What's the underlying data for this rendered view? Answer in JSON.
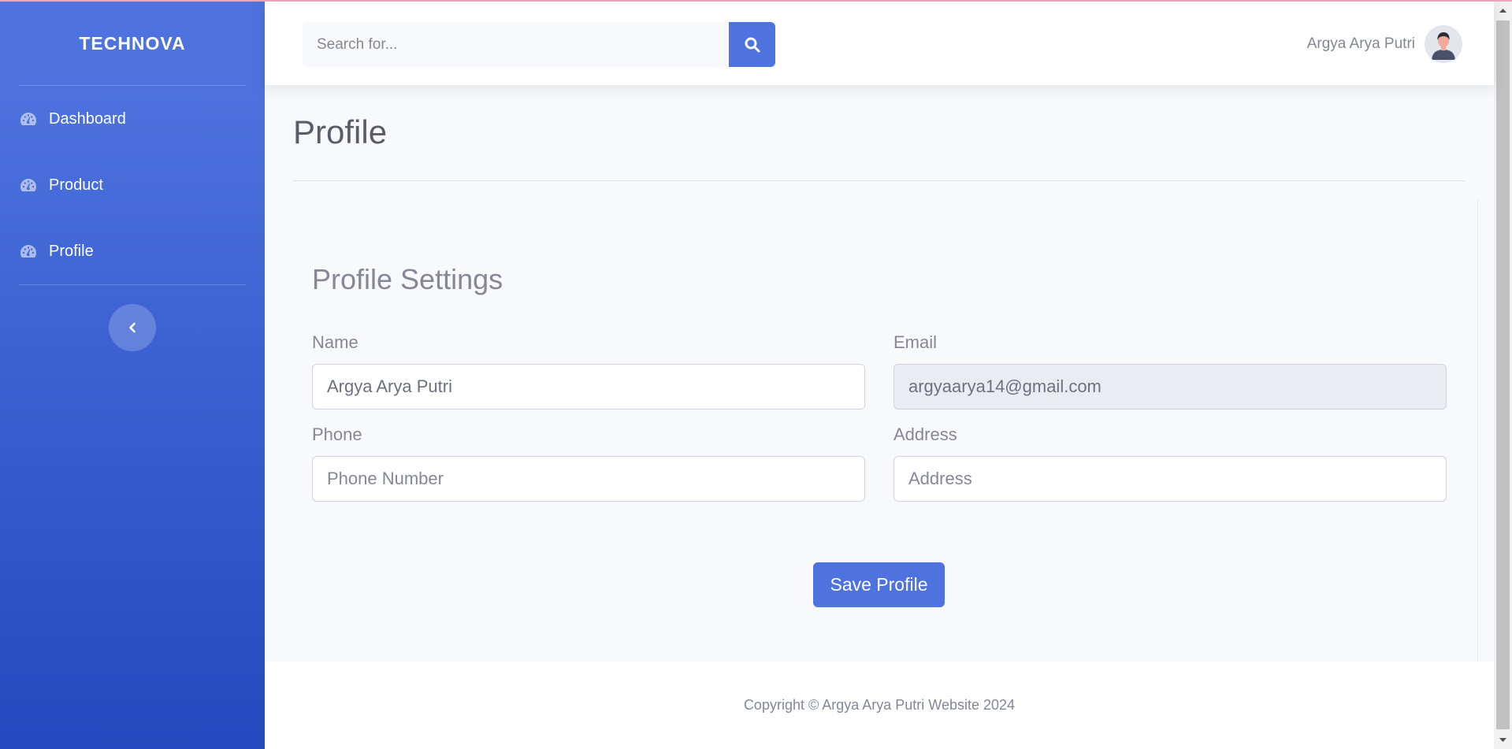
{
  "brand": "TECHNOVA",
  "sidebar": {
    "items": [
      {
        "label": "Dashboard",
        "icon": "tachometer-icon"
      },
      {
        "label": "Product",
        "icon": "tachometer-icon"
      },
      {
        "label": "Profile",
        "icon": "tachometer-icon"
      }
    ],
    "toggle_icon": "chevron-left-icon"
  },
  "topbar": {
    "search_placeholder": "Search for...",
    "search_icon": "search-icon",
    "user_name": "Argya Arya Putri"
  },
  "main": {
    "page_title": "Profile",
    "card_title": "Profile Settings",
    "fields": {
      "name": {
        "label": "Name",
        "value": "Argya Arya Putri",
        "placeholder": ""
      },
      "email": {
        "label": "Email",
        "value": "argyaarya14@gmail.com",
        "placeholder": ""
      },
      "phone": {
        "label": "Phone",
        "value": "",
        "placeholder": "Phone Number"
      },
      "address": {
        "label": "Address",
        "value": "",
        "placeholder": "Address"
      }
    },
    "save_label": "Save Profile"
  },
  "footer": {
    "text": "Copyright © Argya Arya Putri Website 2024"
  },
  "colors": {
    "primary": "#4e73df",
    "sidebar_end": "#224abe",
    "text_muted": "#858796"
  }
}
